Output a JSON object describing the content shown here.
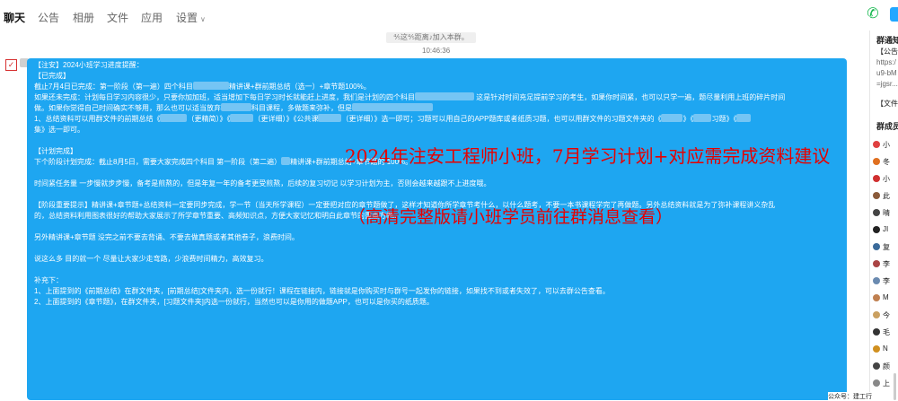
{
  "tabs": [
    {
      "label": "聊天",
      "active": true
    },
    {
      "label": "公告",
      "active": false
    },
    {
      "label": "相册",
      "active": false
    },
    {
      "label": "文件",
      "active": false
    },
    {
      "label": "应用",
      "active": false
    },
    {
      "label": "设置",
      "active": false
    }
  ],
  "system_notice": "⅘这⅘距离♪加入本群。",
  "time": "10:46:36",
  "message": {
    "l1": "【注安】2024小班学习进度提醒：",
    "l2": "【已完成】",
    "l3": "截止7月4日已完成：第一阶段（第一遍）四个科目",
    "l3b": "精讲课+群前期总结（选一）+章节题100%。",
    "l4a": "如果还未完成：计划每日学习内容很少，只要你加加班，适当增加下每日学习时长就能赶上进度，我们是计划的四个科目",
    "l4b": "这是针对时间充足提前学习的考生，如果你时间紧，也可以只学一遍，题尽量利用上班的碎片时间",
    "l5a": "做。如果你觉得自己时间确实不够用，那么也可以适当放弃",
    "l5b": "科目课程，多做题来弥补，但是",
    "l6a": "1、总结资料可以用群文件的前期总结《",
    "l6b": "（更精简）》《",
    "l6c": "（更详细）》《公共课",
    "l6d": "（更详细）》选一即可；习题可以用自己的APP题库或者纸质习题，也可以用群文件的习题文件夹的《",
    "l6e": "》《",
    "l6f": "习题》《",
    "l7": "集》选一即可。",
    "l8": "【计划完成】",
    "l9a": "下个阶段计划完成：截止8月5日，需要大家完成四个科目 第一阶段（第二遍）",
    "l9b": "精讲课+群前期总结+章节题的 100%。",
    "l10": "时间紧任务量 一步慢就步步慢，备考是煎熬的，但是年复一年的备考更受煎熬，后续的复习切记 以学习计划为主，否则会越来越跟不上进度哦。",
    "l11": "【阶段重要提示】精讲课+章节题+总结资料一定要同步完成，学一节（当天所学课程）一定要把对应的章节题做了，这样才知道你所学章节考什么，以什么题考，不要一本书课程学完了再做题。另外总结资料就是为了弥补课程讲义杂乱",
    "l12": "的，总结资料利用图表很好的帮助大家展示了所学章节重要、高频知识点，方便大家记忆和明白此章节的重点方向。",
    "l13": "另外精讲课+章节题 没完之前不要去背诵、不要去做真题或者其他卷子，浪费时间。",
    "l14": "说这么多 目的就一个 尽量让大家少走弯路，少浪费时间精力，高效复习。",
    "l15": "补充下：",
    "l16": "1、上面提到的《前期总结》在群文件夹，[前期总结]文件夹内，选一份就行！课程在链接内，链接就是你购买时与群号一起发你的链接，如果找不到或者失效了，可以去群公告查看。",
    "l17": "2、上面提到的《章节题》，在群文件夹，[习题文件夹]内选一份就行，当然也可以是你用的做题APP，也可以是你买的纸质题。"
  },
  "overlay": {
    "line1": "2024年注安工程师小班，7月学习计划+对应需完成资料建议",
    "line2": "（高清完整版请小班学员前往群消息查看）"
  },
  "sidebar": {
    "notice_title": "群通知",
    "notice_tag": "【公告",
    "notice_lines": [
      "https:/",
      "u9-bM",
      "=jgsr..."
    ],
    "file_tag": "【文件",
    "members_title": "群成员",
    "members": [
      {
        "name": "小",
        "color": "#e04040"
      },
      {
        "name": "冬",
        "color": "#e07020"
      },
      {
        "name": "小",
        "color": "#d03030"
      },
      {
        "name": "此",
        "color": "#8a5a3a"
      },
      {
        "name": "晴",
        "color": "#444444"
      },
      {
        "name": "JI",
        "color": "#222222"
      },
      {
        "name": "复",
        "color": "#3a6a9a"
      },
      {
        "name": "李",
        "color": "#aa4444"
      },
      {
        "name": "李",
        "color": "#6a8ab0"
      },
      {
        "name": "M",
        "color": "#c08050"
      },
      {
        "name": "今",
        "color": "#caa060"
      },
      {
        "name": "毛",
        "color": "#333333"
      },
      {
        "name": "N",
        "color": "#d09020"
      },
      {
        "name": "颜",
        "color": "#444444"
      },
      {
        "name": "上",
        "color": "#888888"
      }
    ]
  },
  "watermark": "公众号：建工行"
}
